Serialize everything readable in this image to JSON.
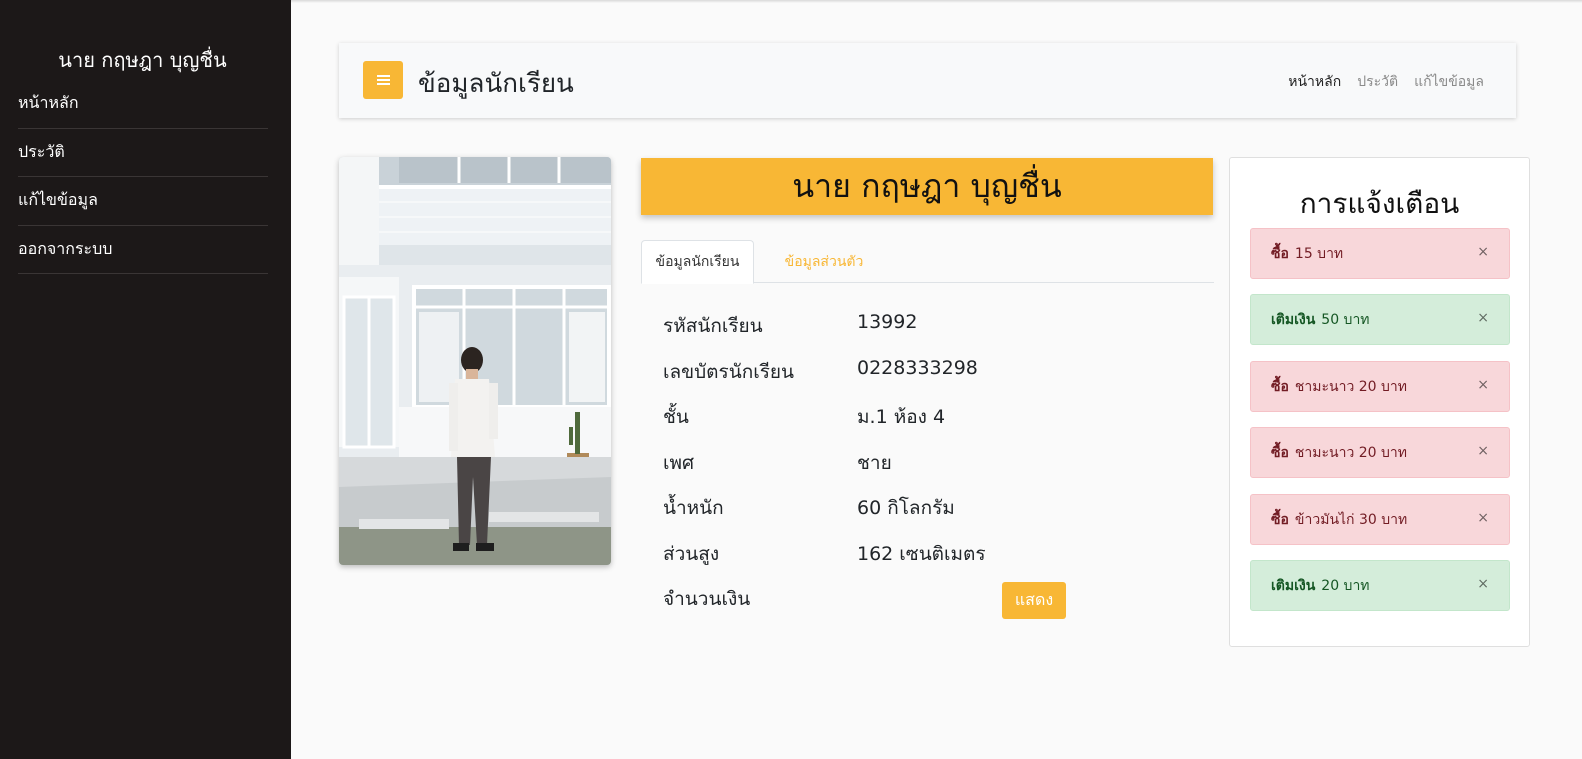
{
  "sidebar": {
    "user_name": "นาย กฤษฎา บุญชื่น",
    "items": [
      {
        "label": "หน้าหลัก"
      },
      {
        "label": "ประวัติ"
      },
      {
        "label": "แก้ไขข้อมูล"
      },
      {
        "label": "ออกจากระบบ"
      }
    ]
  },
  "header": {
    "title": "ข้อมูลนักเรียน",
    "links": [
      {
        "label": "หน้าหลัก"
      },
      {
        "label": "ประวัติ"
      },
      {
        "label": "แก้ไขข้อมูล"
      }
    ]
  },
  "profile": {
    "name": "นาย กฤษฎา บุญชื่น",
    "tabs": [
      {
        "label": "ข้อมูลนักเรียน"
      },
      {
        "label": "ข้อมูลส่วนตัว"
      }
    ],
    "fields": [
      {
        "label": "รหัสนักเรียน",
        "value": "13992"
      },
      {
        "label": "เลขบัตรนักเรียน",
        "value": "0228333298"
      },
      {
        "label": "ชั้น",
        "value": "ม.1 ห้อง 4"
      },
      {
        "label": "เพศ",
        "value": "ชาย"
      },
      {
        "label": "น้ำหนัก",
        "value": "60 กิโลกรัม"
      },
      {
        "label": "ส่วนสูง",
        "value": "162 เซนติเมตร"
      },
      {
        "label": "จำนวนเงิน",
        "value": ""
      }
    ],
    "show_button": "แสดง"
  },
  "notifications": {
    "title": "การแจ้งเตือน",
    "close_symbol": "×",
    "items": [
      {
        "type": "danger",
        "keyword": "ซื้อ",
        "text": "15 บาท"
      },
      {
        "type": "success",
        "keyword": "เติมเงิน",
        "text": "50 บาท"
      },
      {
        "type": "danger",
        "keyword": "ซื้อ",
        "text": "ชามะนาว 20 บาท"
      },
      {
        "type": "danger",
        "keyword": "ซื้อ",
        "text": "ชามะนาว 20 บาท"
      },
      {
        "type": "danger",
        "keyword": "ซื้อ",
        "text": "ข้าวมันไก่ 30 บาท"
      },
      {
        "type": "success",
        "keyword": "เติมเงิน",
        "text": "20 บาท"
      }
    ]
  },
  "colors": {
    "accent": "#f8b735",
    "sidebar_bg": "#1c1818",
    "danger_bg": "#f8d7da",
    "success_bg": "#d4edda"
  }
}
